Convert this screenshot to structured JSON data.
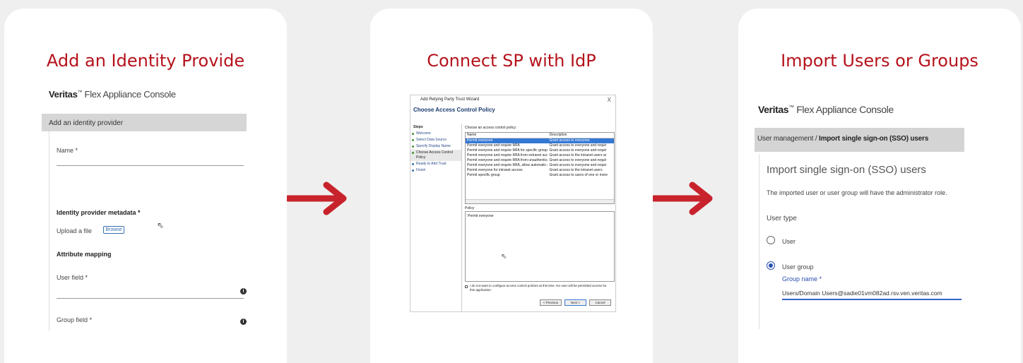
{
  "card1": {
    "title": "Add an Identity Provide",
    "brand": "Veritas",
    "tm": "™",
    "console": " Flex Appliance Console",
    "bar": "Add an identity provider",
    "name_label": "Name *",
    "metadata_label": "Identity provider metadata *",
    "upload_label": "Upload a file",
    "browse": "Browse",
    "attr_label": "Attribute mapping",
    "user_field": "User field *",
    "group_field": "Group field *"
  },
  "card2": {
    "title": "Connect SP with IdP",
    "window_title": "Add Relying Party Trust Wizard",
    "close": "X",
    "heading": "Choose Access Control Policy",
    "steps_title": "Steps",
    "steps": [
      "Welcome",
      "Select Data Source",
      "Specify Display Name",
      "Choose Access Control Policy",
      "Ready to Add Trust",
      "Finish"
    ],
    "choose_label": "Choose an access control policy:",
    "columns": [
      "Name",
      "Description"
    ],
    "rows": [
      [
        "Permit everyone",
        "Grant access to everyone."
      ],
      [
        "Permit everyone and require MFA",
        "Grant access to everyone and requir"
      ],
      [
        "Permit everyone and require MFA for specific group",
        "Grant access to everyone and requir"
      ],
      [
        "Permit everyone and require MFA from extranet access",
        "Grant access to the intranet users ar"
      ],
      [
        "Permit everyone and require MFA from unauthenticated devices",
        "Grant access to everyone and requir"
      ],
      [
        "Permit everyone and require MFA, allow automatic device registr...",
        "Grant access to everyone and requir"
      ],
      [
        "Permit everyone for intranet access",
        "Grant access to the intranet users"
      ],
      [
        "Permit specific group",
        "Grant access to users of one or more"
      ]
    ],
    "policy_label": "Policy",
    "policy_value": "Permit everyone",
    "checkbox_text": "I do not want to configure access control policies at this time. No user will be permitted access for this application.",
    "btn_prev": "< Previous",
    "btn_next": "Next >",
    "btn_cancel": "Cancel"
  },
  "card3": {
    "title": "Import Users or Groups",
    "brand": "Veritas",
    "tm": "™",
    "console": " Flex Appliance Console",
    "bar_prefix": "User management / ",
    "bar_bold": "Import single sign-on (SSO) users",
    "heading": "Import single sign-on (SSO) users",
    "note": "The imported user or user group will have the administrator role.",
    "user_type": "User type",
    "opt_user": "User",
    "opt_group": "User group",
    "group_name_label": "Group name *",
    "group_name_value": "Users/Domain Users@sadie01vm082ad.rsv.ven.veritas.com"
  },
  "colors": {
    "accent": "#b5121b",
    "arrow": "#c8232c",
    "link_blue": "#2a4fb0"
  }
}
